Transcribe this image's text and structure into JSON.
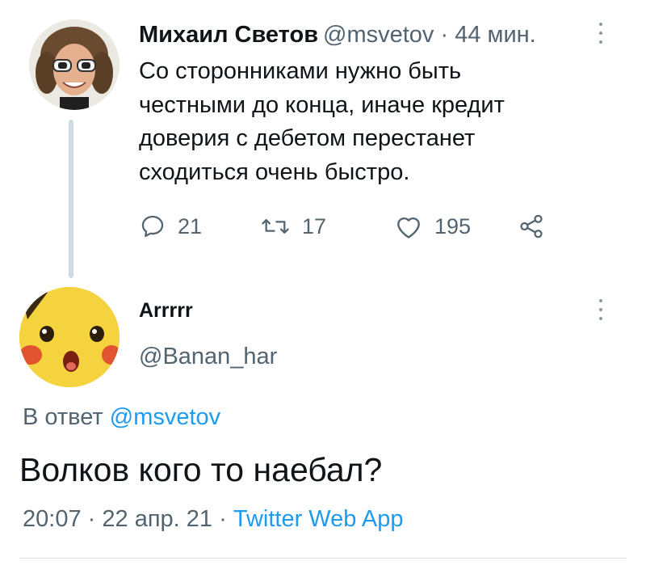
{
  "parent_tweet": {
    "author_name": "Михаил Светов",
    "author_handle": "@msvetov",
    "separator": "·",
    "time_ago": "44 мин.",
    "text_lines": [
      "Со сторонниками нужно быть",
      "честными до конца, иначе кредит",
      "доверия с дебетом перестанет",
      "сходиться очень быстро."
    ],
    "actions": {
      "reply_icon": "reply-icon",
      "replies": "21",
      "retweet_icon": "retweet-icon",
      "retweets": "17",
      "like_icon": "heart-icon",
      "likes": "195",
      "share_icon": "share-icon"
    },
    "more_icon": "more-vertical-icon"
  },
  "reply_tweet": {
    "author_name": "Arrrrr",
    "author_handle": "@Banan_har",
    "more_icon": "more-vertical-icon",
    "replying_to_prefix": "В ответ",
    "replying_to_handle": "@msvetov",
    "text": "Волков кого то наебал?",
    "time": "20:07",
    "separator1": "·",
    "date": "22 апр. 21",
    "separator2": "·",
    "source_app": "Twitter Web App"
  },
  "colors": {
    "text_primary": "#0f1419",
    "text_secondary": "#536471",
    "link": "#1d9bf0",
    "thread_line": "#cfd9de",
    "divider": "#dfe4e8"
  }
}
